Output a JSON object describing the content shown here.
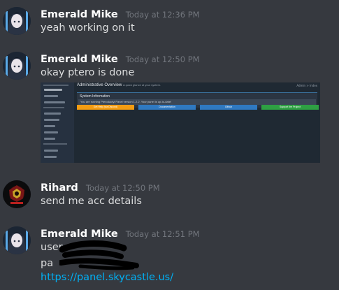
{
  "messages": [
    {
      "username": "Emerald Mike",
      "timestamp": "Today at 12:36 PM",
      "avatar_icon": "anime-character-avatar",
      "lines": [
        "yeah working on it"
      ]
    },
    {
      "username": "Emerald Mike",
      "timestamp": "Today at 12:50 PM",
      "avatar_icon": "anime-character-avatar",
      "lines": [
        "okay ptero is done"
      ],
      "attachment": {
        "type": "image",
        "title": "Administrative Overview",
        "subtitle": "A quick glance at your system.",
        "crumb": "Admin > Index",
        "box_title": "System Information",
        "box_text": "You are running Pterodactyl Panel version 1.2.2. Your panel is up-to-date!",
        "buttons": [
          {
            "label": "Get Help (via Discord)",
            "color": "#f39c12"
          },
          {
            "label": "Documentation",
            "color": "#2f79c1"
          },
          {
            "label": "Github",
            "color": "#2f79c1"
          },
          {
            "label": "Support the Project",
            "color": "#2ea043"
          }
        ]
      }
    },
    {
      "username": "Rihard",
      "timestamp": "Today at 12:50 PM",
      "avatar_icon": "dark-emblem-avatar",
      "lines": [
        "send me acc details"
      ]
    },
    {
      "username": "Emerald Mike",
      "timestamp": "Today at 12:51 PM",
      "avatar_icon": "anime-character-avatar",
      "lines": [
        "user",
        "pa"
      ],
      "link": "https://panel.skycastle.us/"
    }
  ],
  "colors": {
    "background": "#36393f",
    "username": "#ffffff",
    "timestamp": "#72767d",
    "text": "#dcddde",
    "link": "#00b0f4"
  }
}
